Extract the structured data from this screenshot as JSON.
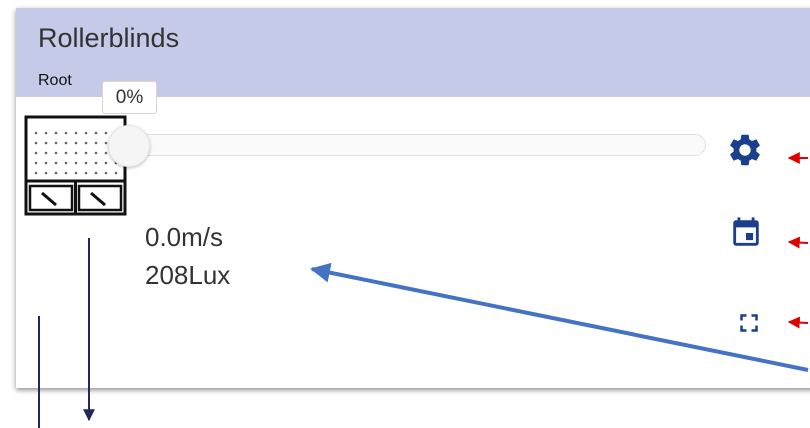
{
  "card": {
    "title": "Rollerblinds",
    "subtitle": "Root",
    "header_color": "#c5cae9"
  },
  "slider": {
    "value_label": "0%",
    "position_fraction": 0
  },
  "sensors": {
    "wind": "0.0m/s",
    "light": "208Lux"
  },
  "actions": [
    {
      "icon": "gear-icon",
      "purpose": "settings"
    },
    {
      "icon": "calendar-icon",
      "purpose": "schedule"
    },
    {
      "icon": "fullscreen-icon",
      "purpose": "fullscreen"
    }
  ],
  "annotations": {
    "accent_colors": {
      "action_icons": "#1a3f8b",
      "red_arrows": "#e00000",
      "blue_arrow": "#4472c4",
      "navy_lines": "#1f2a5a"
    }
  }
}
